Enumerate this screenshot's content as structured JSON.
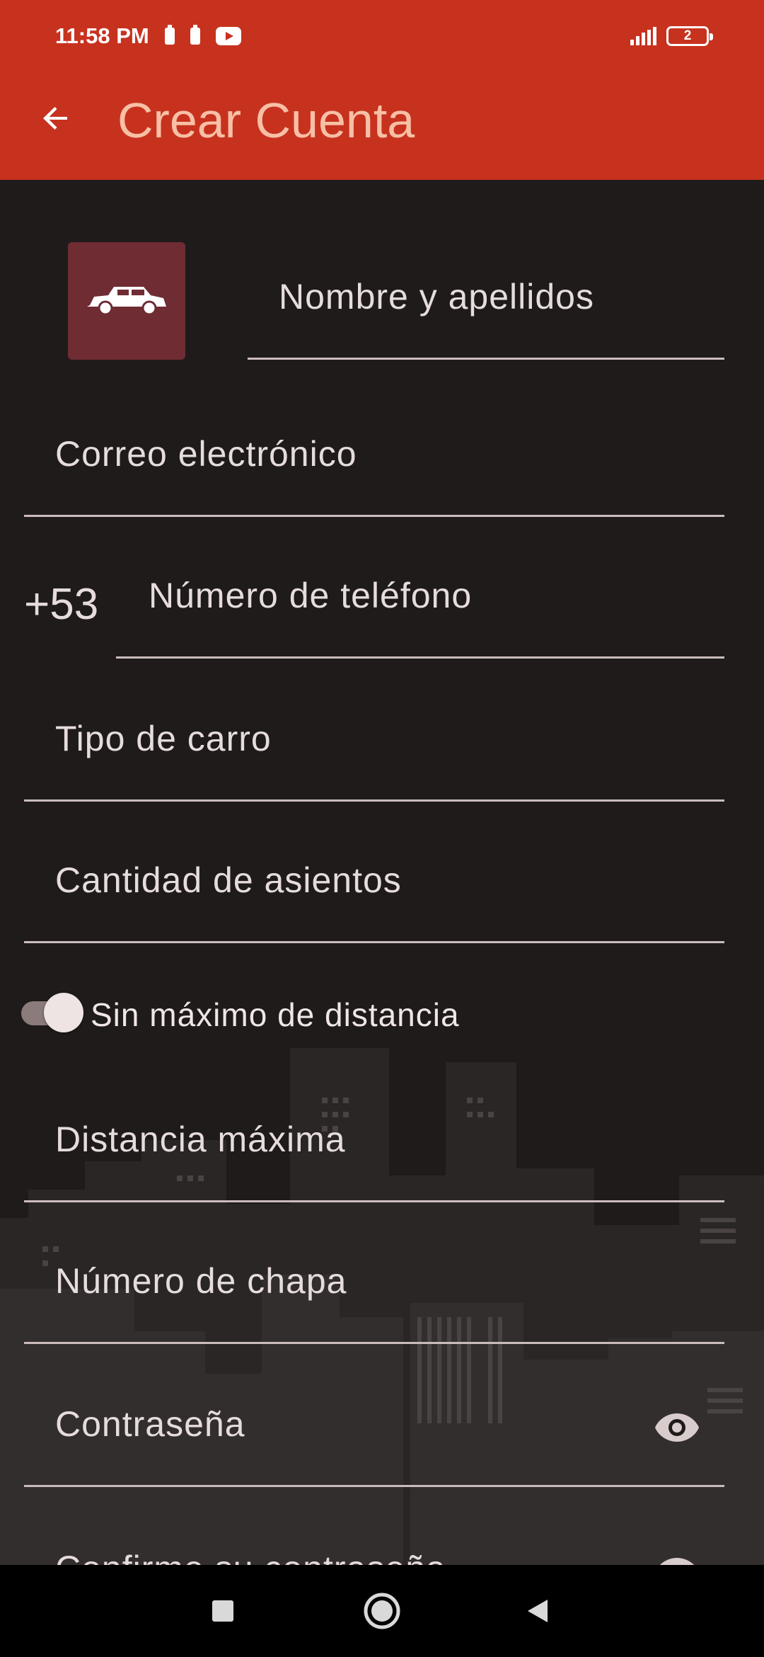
{
  "status_bar": {
    "time": "11:58 PM",
    "battery_level": "2"
  },
  "app_bar": {
    "title": "Crear Cuenta",
    "back_icon": "arrow-back-icon",
    "color": "#c7321f"
  },
  "form": {
    "avatar_icon": "car-icon",
    "full_name_placeholder": "Nombre y apellidos",
    "email_placeholder": "Correo electrónico",
    "phone_prefix": "+53",
    "phone_placeholder": "Número de teléfono",
    "car_type_placeholder": "Tipo de carro",
    "seats_placeholder": "Cantidad de asientos",
    "no_max_distance_toggle": {
      "label": "Sin máximo de distancia",
      "checked": true
    },
    "max_distance_placeholder": "Distancia máxima",
    "plate_placeholder": "Número de chapa",
    "password_placeholder": "Contraseña",
    "confirm_password_placeholder": "Confirme su contraseña"
  },
  "nav_bar": {
    "recents_icon": "square-icon",
    "home_icon": "circle-icon",
    "back_icon": "triangle-back-icon"
  }
}
